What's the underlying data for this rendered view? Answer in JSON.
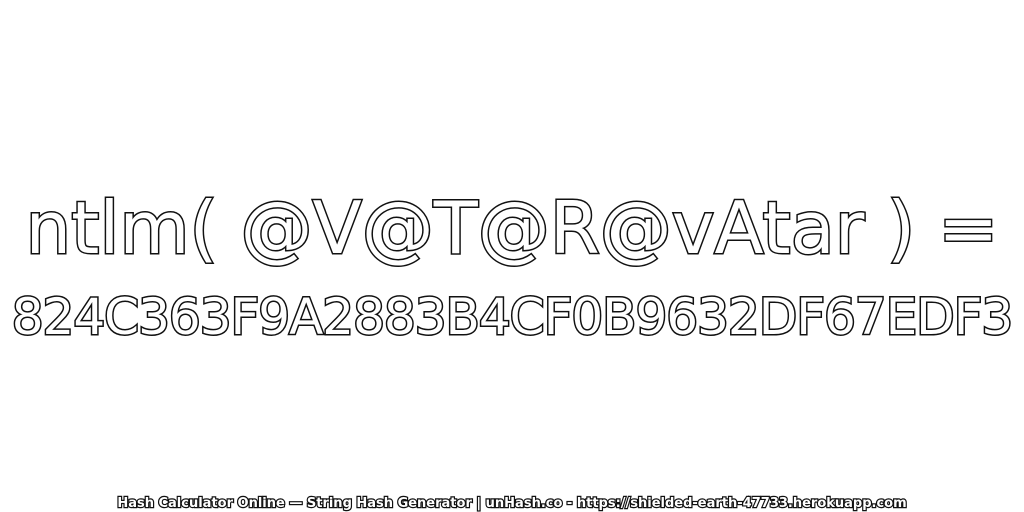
{
  "expression": "ntlm( @V@T@R@vAtar ) =",
  "hash_value": "824C363F9A2883B4CF0B9632DF67EDF3",
  "footer": "Hash Calculator Online — String Hash Generator | unHash.co - https://shielded-earth-47733.herokuapp.com",
  "colors": {
    "background": "#ffffff",
    "text_fill": "#ffffff",
    "text_outline": "#111111"
  }
}
